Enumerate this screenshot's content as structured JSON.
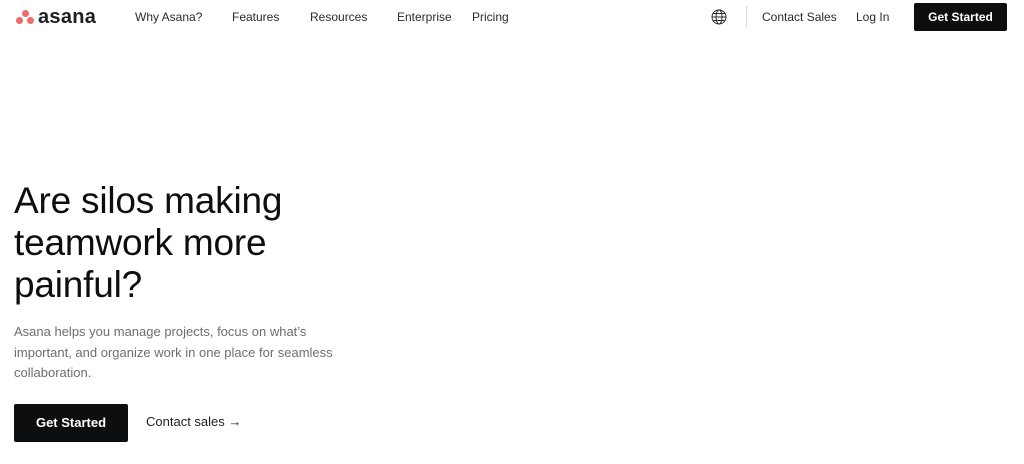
{
  "brand": {
    "name": "asana",
    "accent_color": "#f06a6a"
  },
  "nav": {
    "links": [
      "Why Asana?",
      "Features",
      "Resources",
      "Enterprise",
      "Pricing"
    ],
    "globe_icon": "globe-icon",
    "contact_sales": "Contact Sales",
    "log_in": "Log In",
    "get_started": "Get Started"
  },
  "hero": {
    "title": "Are silos making teamwork more painful?",
    "subtitle": "Asana helps you manage projects, focus on what’s important, and organize work in one place for seamless collaboration.",
    "primary_cta": "Get Started",
    "secondary_cta": "Contact sales →"
  }
}
